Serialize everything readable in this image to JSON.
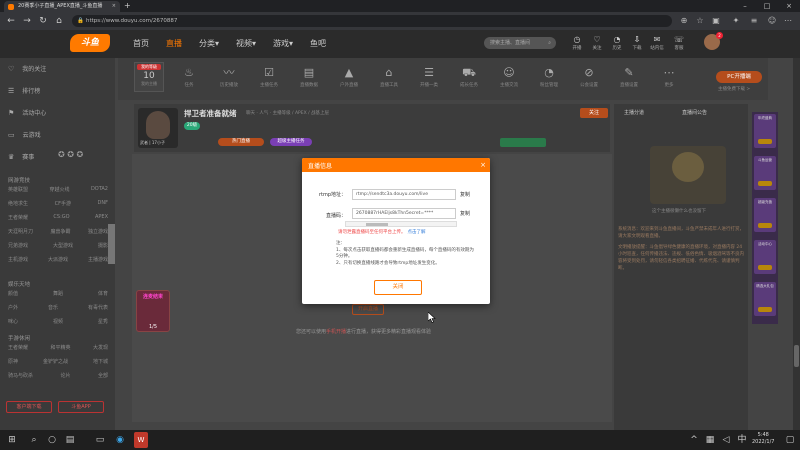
{
  "browser": {
    "tab_title": "20赛季小子直播_APEX直播_斗鱼直播",
    "url": "https://www.douyu.com/2670887"
  },
  "header": {
    "logo": "斗鱼",
    "nav": [
      "首页",
      "直播",
      "分类▾",
      "视频▾",
      "游戏▾",
      "鱼吧"
    ],
    "search_placeholder": "搜索主播、直播间",
    "icons": [
      "开播",
      "关注",
      "历史",
      "下载",
      "站内信",
      "客服"
    ],
    "avatar_badge": "2"
  },
  "sidebar": {
    "items": [
      "我的关注",
      "排行榜",
      "活动中心",
      "云游戏",
      "赛事"
    ],
    "sections": [
      {
        "title": "网游竞技",
        "rows": [
          [
            "英雄联盟",
            "穿越火线",
            "DOTA2"
          ],
          [
            "绝地求生",
            "CF手游",
            "DNF"
          ],
          [
            "王者荣耀",
            "CS:GO",
            "APEX"
          ],
          [
            "天涯明月刀",
            "魔兽争霸",
            "独立游戏"
          ],
          [
            "兄弟游戏",
            "大型游戏",
            "摄影"
          ],
          [
            "主机游戏",
            "大派游戏",
            "主播游戏"
          ]
        ]
      },
      {
        "title": "娱乐天地",
        "rows": [
          [
            "颜值",
            "舞蹈",
            "体育"
          ],
          [
            "户外",
            "音乐",
            "有毒代表"
          ],
          [
            "咪心",
            "视频",
            "星秀"
          ]
        ]
      },
      {
        "title": "手游休闲",
        "rows": [
          [
            "王者荣耀",
            "和平精英",
            "大发现"
          ],
          [
            "原神",
            "金铲铲之战",
            "地下城"
          ],
          [
            "骑马与砍杀",
            "论片",
            "全部"
          ]
        ]
      }
    ],
    "btn_download": "客户端下载",
    "btn_app": "斗鱼APP"
  },
  "categories": {
    "tag_top": "我的等级",
    "tag_num": "10",
    "tag_sub": "我的主播",
    "items": [
      "任务",
      "历史播放",
      "主播任务",
      "直播数据",
      "户外直播",
      "直播工具",
      "开播一类",
      "成长任务",
      "主播交流",
      "粉丝管理",
      "公会设置",
      "直播设置",
      "更多"
    ],
    "pc_btn": "PC开播端",
    "pc_sub": "主播免费下载 >"
  },
  "streamer": {
    "title": "捍卫者准备就绪",
    "meta": "聊天 · 人气 · 主播等级 / APEX / 战基上层",
    "name": "武者 | 17小子",
    "level_pill": "20级",
    "hot_pill": "热门直播",
    "task_pill": "超级主播任务",
    "follow": "关注"
  },
  "player": {
    "pk_title": "连麦结束",
    "pk_value": "1/5",
    "ghost_btn": "开启直播",
    "message_pre": "您还可以使用",
    "message_link": "手机开播",
    "message_post": "进行直播，获得更多精彩直播观看体验"
  },
  "right_panel": {
    "tabs": [
      "主播分道",
      "直播间公告"
    ],
    "caption": "这个主播很懒什么也没留下",
    "paragraphs": [
      "系统消息：欢迎来到斗鱼直播间，斗鱼严禁未成年人进行打赏，请大家文明观看直播。",
      "文明播放提醒：斗鱼倡导绿色健康的直播环境，对直播内容 24 小时巡查，任何传播违法、违规、低俗色情、吸烟酒驾等不良内容将受到处罚，请勿轻信各类招聘征婚、代练代充、请谨慎判断。"
    ],
    "side_cards": [
      "年终盛典",
      "斗鱼运营",
      "超级充值",
      "活动中心",
      "精选大礼包"
    ]
  },
  "modal": {
    "title": "直播信息",
    "close_glyph": "×",
    "rtmp_label": "rtmp地址：",
    "rtmp_value": "rtmp://sendtc3a.douyu.com/live",
    "copy_label": "复制",
    "code_label": "直播码：",
    "code_value": "2670887rHAEIjs8kThn5ecret=****",
    "warning": "请勿泄露直播码至任何平台上传。",
    "learn_more": "点击了解",
    "note_title": "注：",
    "notes": [
      "1、每次点击获取直播码都会重新生成直播码，每个直播码的有效期为5分钟。",
      "2、只有切换直播线路才会导致rtmp地址发生变化。"
    ],
    "close_button": "关闭"
  },
  "taskbar": {
    "time": "5:48",
    "date": "2022/1/7"
  },
  "colors": {
    "brand": "#ff7700",
    "warning": "#e44444",
    "link": "#2f7ad8"
  }
}
